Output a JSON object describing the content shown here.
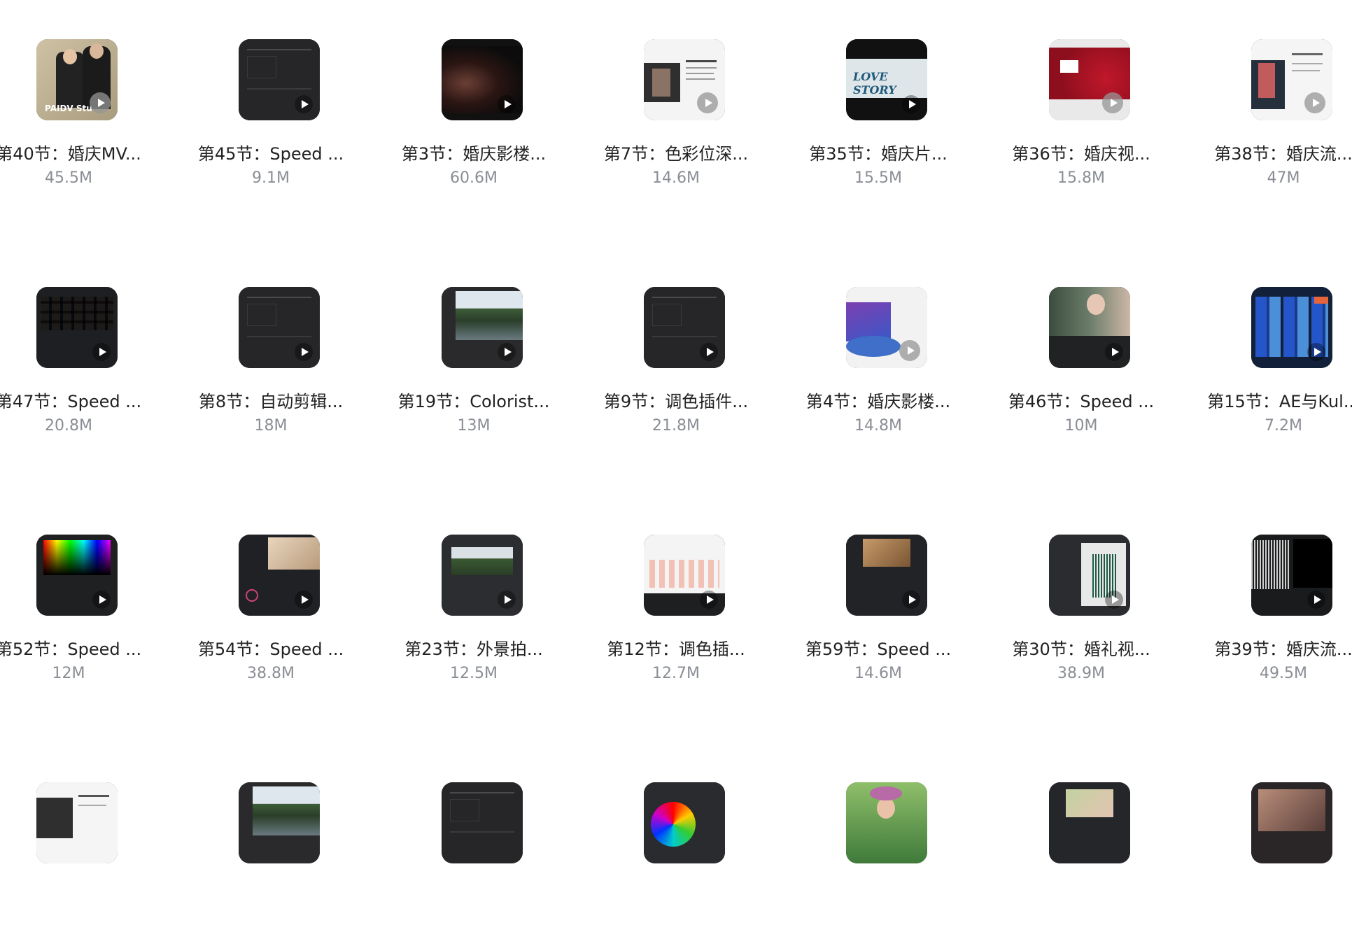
{
  "files": [
    {
      "name": "第40节：婚庆MV...",
      "size": "45.5M",
      "thumb": "wedding-couple",
      "play_style": "light"
    },
    {
      "name": "第45节：Speed ...",
      "size": "9.1M",
      "thumb": "dark-ui",
      "play_style": "dark"
    },
    {
      "name": "第3节：婚庆影楼...",
      "size": "60.6M",
      "thumb": "hands-dark",
      "play_style": "dark"
    },
    {
      "name": "第7节：色彩位深...",
      "size": "14.6M",
      "thumb": "slide-doc",
      "play_style": "light"
    },
    {
      "name": "第35节：婚庆片...",
      "size": "15.5M",
      "thumb": "love-story-title",
      "play_style": "dark"
    },
    {
      "name": "第36节：婚庆视...",
      "size": "15.8M",
      "thumb": "red-roses",
      "play_style": "light"
    },
    {
      "name": "第38节：婚庆流...",
      "size": "47M",
      "thumb": "slide-photo",
      "play_style": "light"
    },
    {
      "name": "第47节：Speed ...",
      "size": "20.8M",
      "thumb": "thumbnail-grid-ui",
      "play_style": "dark"
    },
    {
      "name": "第8节：自动剪辑...",
      "size": "18M",
      "thumb": "dark-ui",
      "play_style": "dark"
    },
    {
      "name": "第19节：Colorist...",
      "size": "13M",
      "thumb": "lake-ui",
      "play_style": "dark"
    },
    {
      "name": "第9节：调色插件...",
      "size": "21.8M",
      "thumb": "dark-ui",
      "play_style": "dark"
    },
    {
      "name": "第4节：婚庆影楼...",
      "size": "14.8M",
      "thumb": "purple-room-slide",
      "play_style": "light"
    },
    {
      "name": "第46节：Speed ...",
      "size": "10M",
      "thumb": "portrait-ui",
      "play_style": "dark"
    },
    {
      "name": "第15节：AE与Kul...",
      "size": "7.2M",
      "thumb": "color-swatch-ui",
      "play_style": "dark"
    },
    {
      "name": "第52节：Speed ...",
      "size": "12M",
      "thumb": "spectrum-ui",
      "play_style": "dark"
    },
    {
      "name": "第54节：Speed ...",
      "size": "38.8M",
      "thumb": "bed-scene-ui",
      "play_style": "dark"
    },
    {
      "name": "第23节：外景拍...",
      "size": "12.5M",
      "thumb": "forest-ui",
      "play_style": "dark"
    },
    {
      "name": "第12节：调色插...",
      "size": "12.7M",
      "thumb": "girls-ui",
      "play_style": "dark"
    },
    {
      "name": "第59节：Speed ...",
      "size": "14.6M",
      "thumb": "skin-ui",
      "play_style": "dark"
    },
    {
      "name": "第30节：婚礼视...",
      "size": "38.9M",
      "thumb": "waveform-ui",
      "play_style": "dark"
    },
    {
      "name": "第39节：婚庆流...",
      "size": "49.5M",
      "thumb": "waveform-dark",
      "play_style": "dark"
    },
    {
      "name": "",
      "size": "",
      "thumb": "slide-doc-logo",
      "play_style": "none"
    },
    {
      "name": "",
      "size": "",
      "thumb": "lake-ui",
      "play_style": "none"
    },
    {
      "name": "",
      "size": "",
      "thumb": "dark-ui",
      "play_style": "none"
    },
    {
      "name": "",
      "size": "",
      "thumb": "color-wheel-ui",
      "play_style": "none"
    },
    {
      "name": "",
      "size": "",
      "thumb": "garden-girl",
      "play_style": "none"
    },
    {
      "name": "",
      "size": "",
      "thumb": "couple-ui",
      "play_style": "none"
    },
    {
      "name": "",
      "size": "",
      "thumb": "sepia-ui",
      "play_style": "none"
    }
  ]
}
